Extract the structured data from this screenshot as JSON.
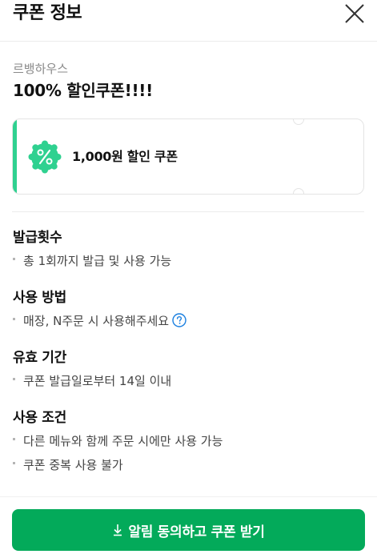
{
  "header": {
    "title": "쿠폰 정보",
    "close_icon": "close-icon"
  },
  "coupon": {
    "store_name": "르뱅하우스",
    "title": "100% 할인쿠폰!!!!",
    "card_name": "1,000원 할인 쿠폰",
    "badge_icon": "percent-badge-icon",
    "accent_color": "#2fd190"
  },
  "sections": {
    "issue_count": {
      "title": "발급횟수",
      "items": [
        "총 1회까지 발급 및 사용 가능"
      ]
    },
    "usage_method": {
      "title": "사용 방법",
      "items": [
        "매장, N주문 시 사용해주세요"
      ],
      "help_icon": "question-circle-icon"
    },
    "validity": {
      "title": "유효 기간",
      "items": [
        "쿠폰 발급일로부터 14일 이내"
      ]
    },
    "conditions": {
      "title": "사용 조건",
      "items": [
        "다른 메뉴와 함께 주문 시에만 사용 가능",
        "쿠폰 중복 사용 불가"
      ]
    }
  },
  "action": {
    "button_label": "알림 동의하고 쿠폰 받기",
    "button_icon": "download-icon",
    "button_color": "#03aa5a"
  }
}
